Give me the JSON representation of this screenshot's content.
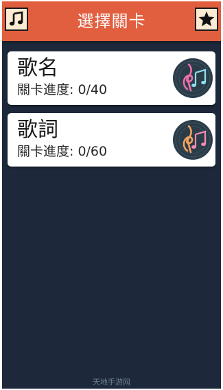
{
  "header": {
    "title": "選擇關卡",
    "left_icon": "music-note-icon",
    "right_icon": "star-icon"
  },
  "levels": [
    {
      "name": "歌名",
      "progress": "關卡進度: 0/40",
      "icon": "music-disc-icon"
    },
    {
      "name": "歌詞",
      "progress": "關卡進度: 0/60",
      "icon": "music-disc-icon"
    }
  ],
  "watermark": "天地手游网",
  "colors": {
    "header": "#e15e3e",
    "background": "#1d293b",
    "card": "#ffffff",
    "button": "#fcebd2"
  }
}
